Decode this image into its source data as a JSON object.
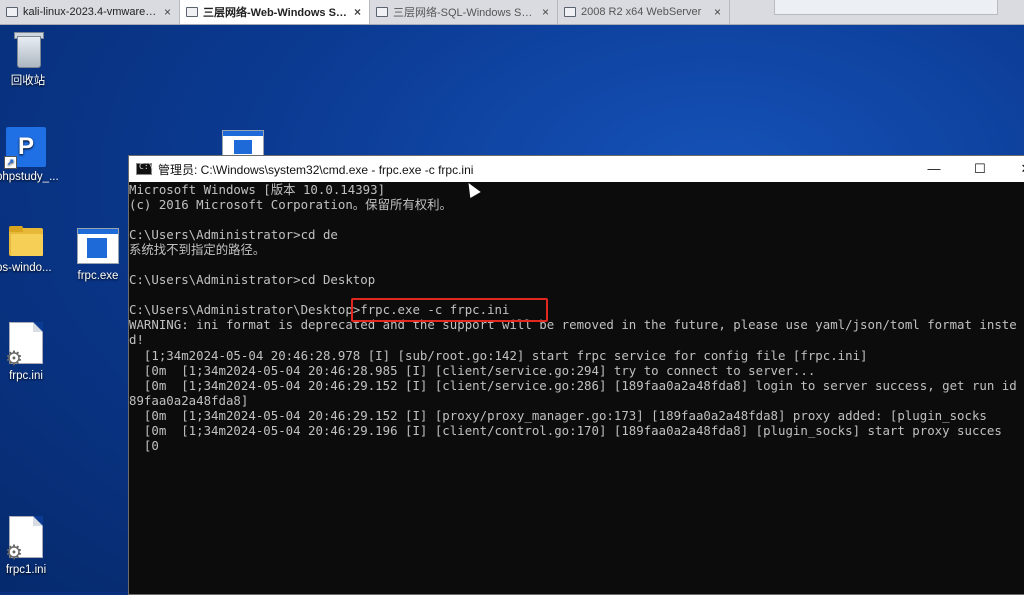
{
  "tabs": [
    {
      "label": "kali-linux-2023.4-vmware-am...",
      "close": "×",
      "active": false
    },
    {
      "label": "三层网络-Web-Windows Se...",
      "close": "×",
      "active": true
    },
    {
      "label": "三层网络-SQL-Windows Serve...",
      "close": "×",
      "active": false
    },
    {
      "label": "2008 R2 x64 WebServer",
      "close": "×",
      "active": false
    }
  ],
  "desktop_icons": [
    {
      "label": "回收站",
      "icon": "recycle-bin-icon"
    },
    {
      "label": "phpstudy_...",
      "icon": "phpstudy-icon"
    },
    {
      "label": "ps-windo...",
      "icon": "folder-icon"
    },
    {
      "label": "frpc.exe",
      "icon": "application-icon"
    },
    {
      "label": "frpc.ini",
      "icon": "config-file-icon"
    },
    {
      "label": "frpc1.ini",
      "icon": "config-file-icon"
    }
  ],
  "window": {
    "title": "管理员: C:\\Windows\\system32\\cmd.exe - frpc.exe  -c frpc.ini",
    "minimize": "—",
    "maximize": "☐",
    "close": "✕"
  },
  "console_lines": [
    "Microsoft Windows [版本 10.0.14393]",
    "(c) 2016 Microsoft Corporation。保留所有权利。",
    "",
    "C:\\Users\\Administrator>cd de",
    "系统找不到指定的路径。",
    "",
    "C:\\Users\\Administrator>cd Desktop",
    "",
    "C:\\Users\\Administrator\\Desktop>frpc.exe -c frpc.ini",
    "WARNING: ini format is deprecated and the support will be removed in the future, please use yaml/json/toml format inste",
    "d!",
    "  [1;34m2024-05-04 20:46:28.978 [I] [sub/root.go:142] start frpc service for config file [frpc.ini]",
    "  [0m  [1;34m2024-05-04 20:46:28.985 [I] [client/service.go:294] try to connect to server...",
    "  [0m  [1;34m2024-05-04 20:46:29.152 [I] [client/service.go:286] [189faa0a2a48fda8] login to server success, get run id",
    "89faa0a2a48fda8]",
    "  [0m  [1;34m2024-05-04 20:46:29.152 [I] [proxy/proxy_manager.go:173] [189faa0a2a48fda8] proxy added: [plugin_socks",
    "  [0m  [1;34m2024-05-04 20:46:29.196 [I] [client/control.go:170] [189faa0a2a48fda8] [plugin_socks] start proxy succes",
    "  [0"
  ],
  "colors": {
    "highlight_box": "#e0281f",
    "console_bg": "#0c0c0c",
    "console_text": "#c0c0c0"
  }
}
